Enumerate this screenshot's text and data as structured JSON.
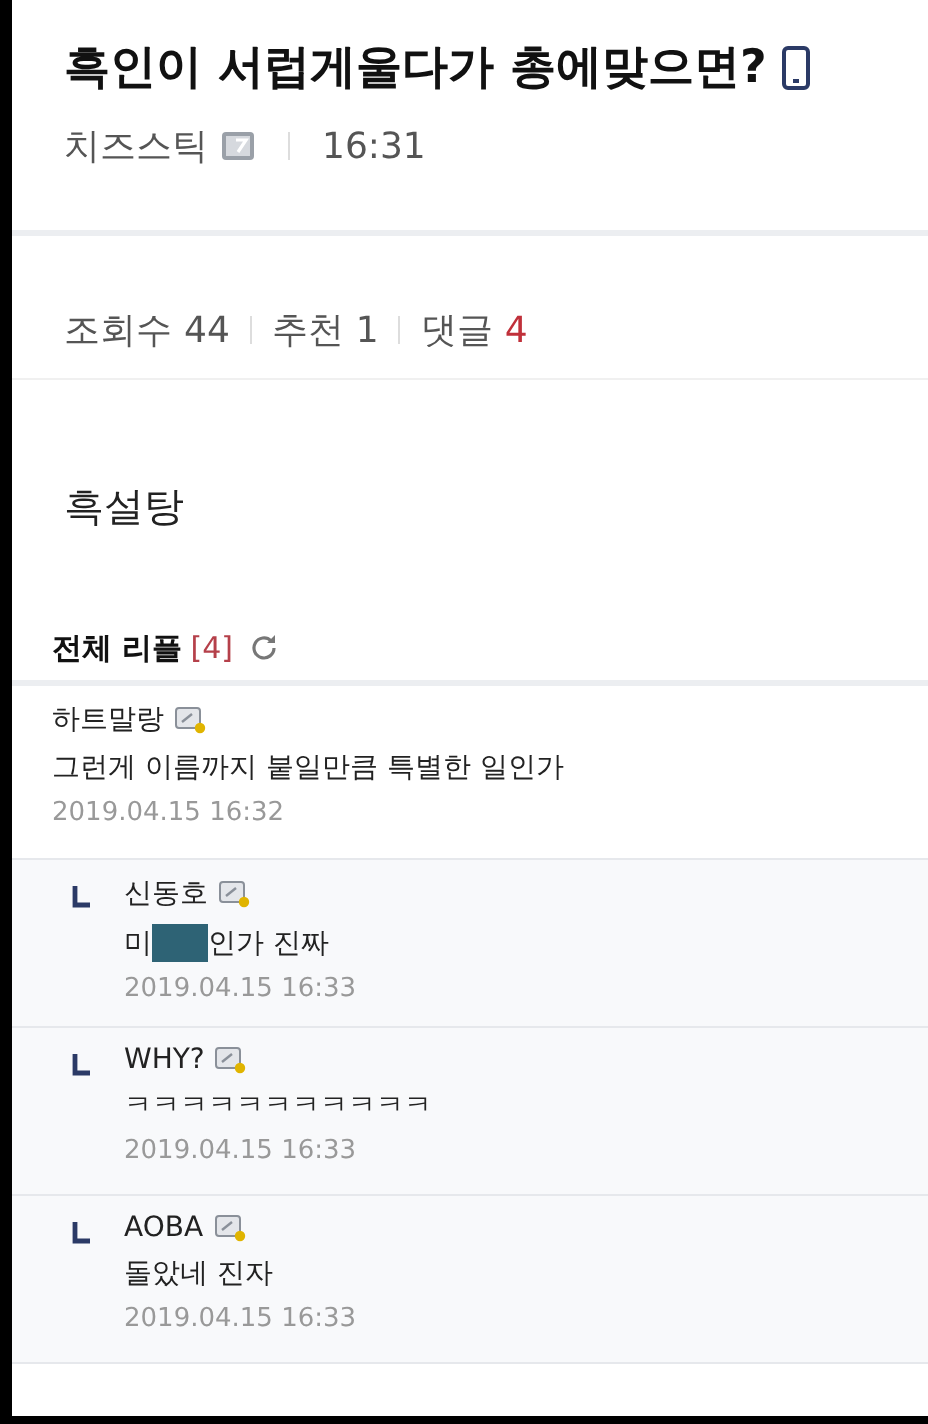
{
  "post": {
    "title": "흑인이 서럽게울다가 총에맞으면?",
    "author": "치즈스틱",
    "time": "16:31"
  },
  "stats": [
    {
      "label": "조회수",
      "value": "44",
      "highlight": false
    },
    {
      "label": "추천",
      "value": "1",
      "highlight": false
    },
    {
      "label": "댓글",
      "value": "4",
      "highlight": true
    }
  ],
  "body": "흑설탕",
  "replies_header": {
    "title": "전체 리플",
    "count": "[4]"
  },
  "comments": [
    {
      "kind": "comment",
      "author": "하트말랑",
      "segments": [
        {
          "kind": "text",
          "text": "그런게 이름까지 붙일만큼 특별한 일인가"
        }
      ],
      "date": "2019.04.15 16:32"
    },
    {
      "kind": "reply",
      "author": "신동호",
      "segments": [
        {
          "kind": "text",
          "text": "미"
        },
        {
          "kind": "redaction"
        },
        {
          "kind": "text",
          "text": "인가 진짜"
        }
      ],
      "date": "2019.04.15 16:33"
    },
    {
      "kind": "reply",
      "author": "WHY?",
      "segments": [
        {
          "kind": "text",
          "text": "ㅋㅋㅋㅋㅋㅋㅋㅋㅋㅋㅋ"
        }
      ],
      "date": "2019.04.15 16:33"
    },
    {
      "kind": "reply",
      "author": "AOBA",
      "segments": [
        {
          "kind": "text",
          "text": "돌았네 진자"
        }
      ],
      "date": "2019.04.15 16:33"
    }
  ]
}
